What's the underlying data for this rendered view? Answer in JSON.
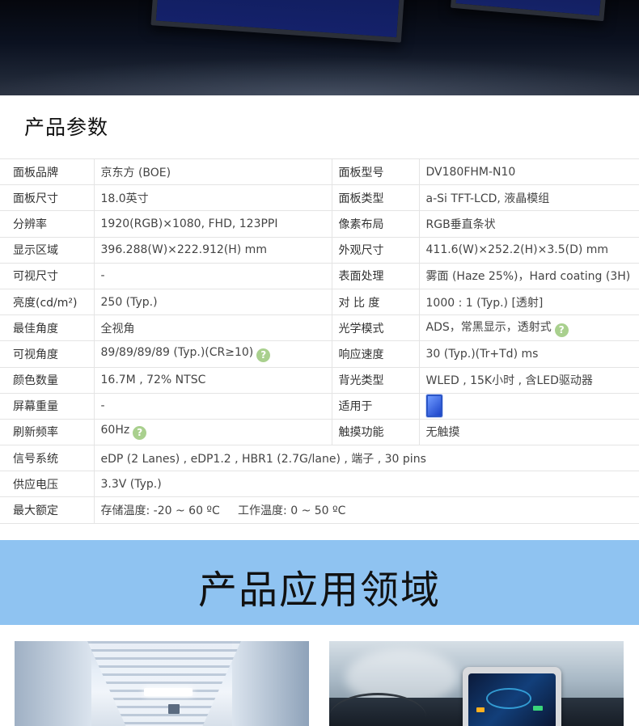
{
  "section": {
    "title": "产品参数"
  },
  "specs": {
    "rows": [
      {
        "k1": "面板品牌",
        "v1": "京东方 (BOE)",
        "k2": "面板型号",
        "v2": "DV180FHM-N10"
      },
      {
        "k1": "面板尺寸",
        "v1": "18.0英寸",
        "k2": "面板类型",
        "v2": "a-Si TFT-LCD, 液晶模组"
      },
      {
        "k1": "分辨率",
        "v1": "1920(RGB)×1080, FHD, 123PPI",
        "k2": "像素布局",
        "v2": "RGB垂直条状"
      },
      {
        "k1": "显示区域",
        "v1": "396.288(W)×222.912(H) mm",
        "k2": "外观尺寸",
        "v2": "411.6(W)×252.2(H)×3.5(D) mm"
      },
      {
        "k1": "可视尺寸",
        "v1": "-",
        "k2": "表面处理",
        "v2": "雾面 (Haze 25%)，Hard coating (3H)"
      },
      {
        "k1": "亮度(cd/m²)",
        "v1": "250 (Typ.)",
        "k2": "对 比 度",
        "v2": "1000 : 1 (Typ.) [透射]"
      },
      {
        "k1": "最佳角度",
        "v1": "全视角",
        "k2": "光学模式",
        "v2": "ADS，常黑显示，透射式"
      },
      {
        "k1": "可视角度",
        "v1": "89/89/89/89 (Typ.)(CR≥10)",
        "k2": "响应速度",
        "v2": "30 (Typ.)(Tr+Td) ms"
      },
      {
        "k1": "颜色数量",
        "v1": "16.7M , 72% NTSC",
        "k2": "背光类型",
        "v2": "WLED , 15K小时 , 含LED驱动器"
      },
      {
        "k1": "屏幕重量",
        "v1": "-",
        "k2": "适用于",
        "v2": ""
      },
      {
        "k1": "刷新频率",
        "v1": "60Hz",
        "k2": "触摸功能",
        "v2": "无触摸"
      },
      {
        "k1": "信号系统",
        "v1": "eDP (2 Lanes) , eDP1.2 , HBR1 (2.7G/lane) , 端子 , 30 pins"
      },
      {
        "k1": "供应电压",
        "v1": "3.3V (Typ.)"
      },
      {
        "k1": "最大额定",
        "v1": "存储温度: -20 ~ 60 ºC     工作温度: 0 ~ 50 ºC"
      }
    ],
    "help_symbol": "?",
    "colors": {
      "link": "#2d5a9e",
      "help_icon": "#a9d08e",
      "border": "#e4e4e4"
    }
  },
  "applications": {
    "title": "产品应用领域",
    "background_color": "#8fc3f1"
  }
}
